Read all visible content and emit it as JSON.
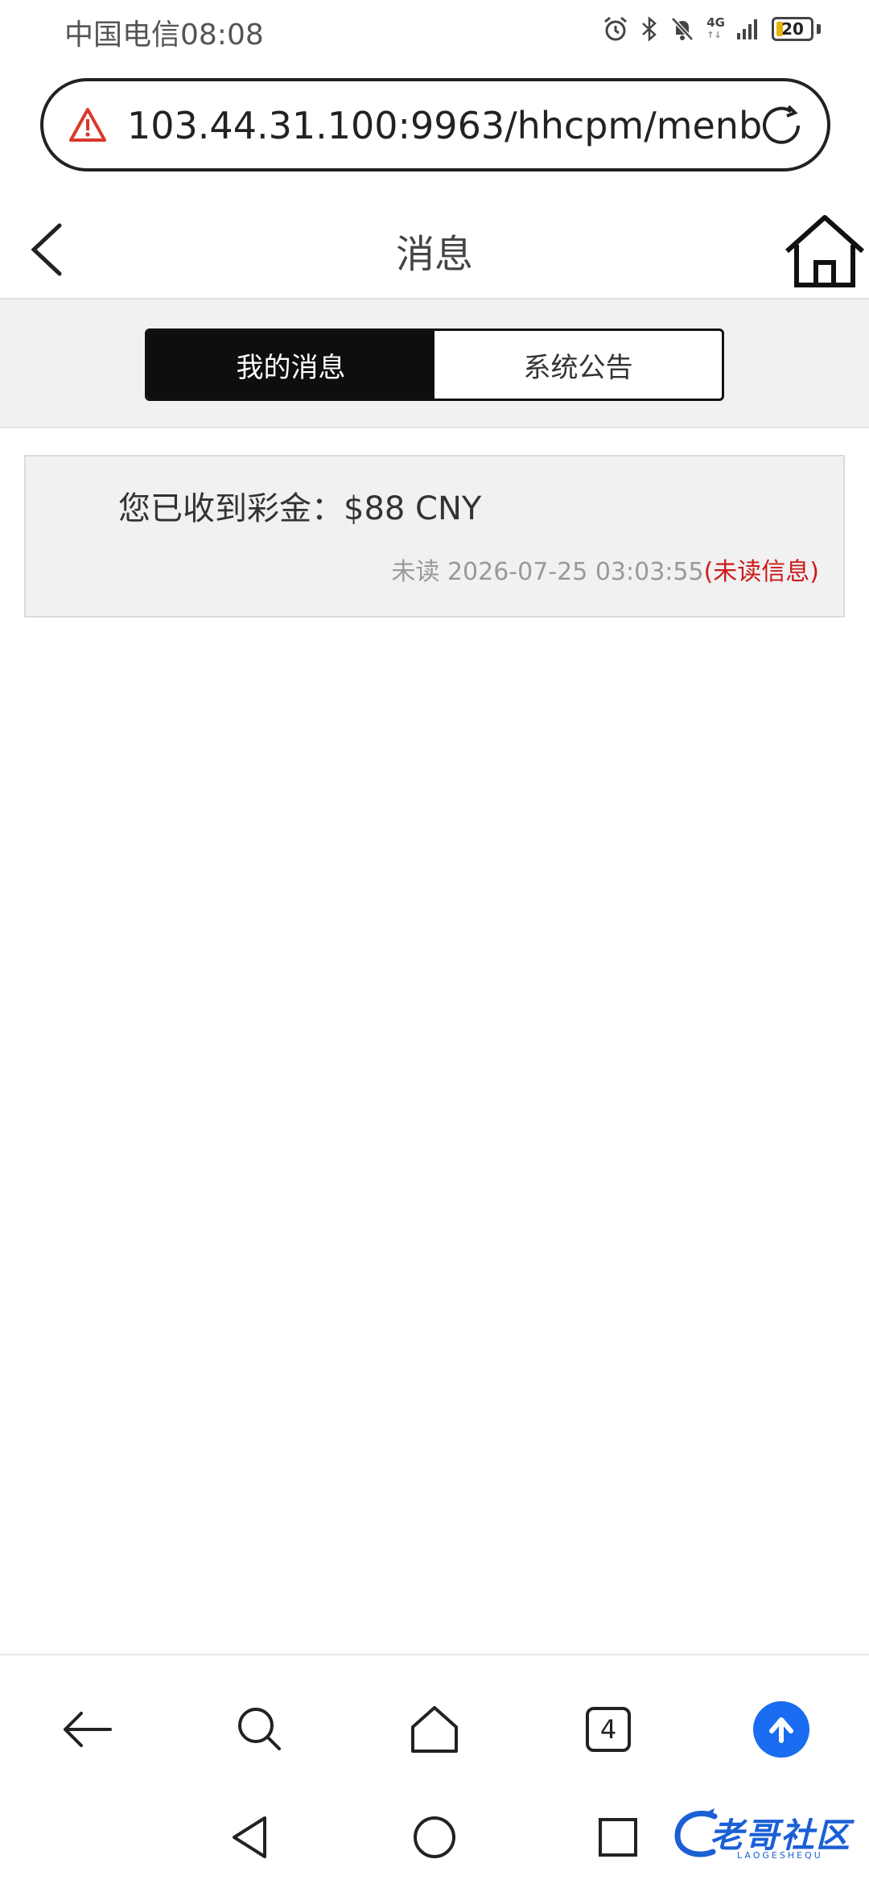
{
  "status_bar": {
    "carrier_time": "中国电信08:08",
    "network": "4G",
    "battery_level": "20",
    "battery_fraction": 0.2,
    "icons": [
      "alarm-icon",
      "bluetooth-icon",
      "bell-muted-icon",
      "signal-icon",
      "battery-icon"
    ]
  },
  "browser": {
    "url": "103.44.31.100:9963/hhcpm/menb",
    "tabs_count": "4",
    "icons": [
      "warning-icon",
      "refresh-icon",
      "back-arrow-icon",
      "search-icon",
      "home-icon",
      "tabs-icon",
      "upload-icon"
    ]
  },
  "page": {
    "title": "消息",
    "tabs": [
      {
        "label": "我的消息",
        "active": true
      },
      {
        "label": "系统公告",
        "active": false
      }
    ]
  },
  "messages": [
    {
      "text": "您已收到彩金：$88 CNY",
      "status": "未读",
      "time": "2026-07-25 03:03:55",
      "flag": "(未读信息)"
    }
  ],
  "watermark": {
    "text": "老哥社区",
    "sub": "LAOGESHEQU"
  },
  "colors": {
    "accent_blue": "#1a6cf0",
    "unread_red": "#cc1a1a",
    "warning_red": "#d9382b",
    "tab_active_bg": "#0e0e0e"
  }
}
